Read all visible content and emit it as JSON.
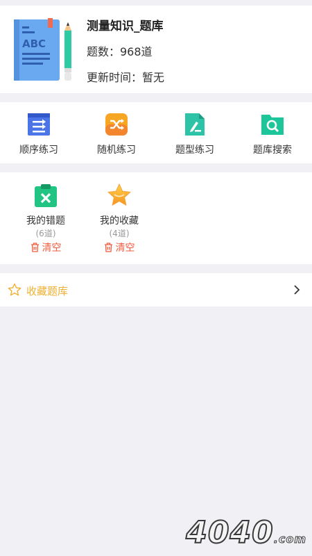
{
  "header": {
    "title": "测量知识_题库",
    "question_count": "题数：968道",
    "update_time": "更新时间：暂无",
    "book_text": "ABC"
  },
  "practice": [
    {
      "label": "顺序练习",
      "icon": "sequence-list-icon",
      "color": "#4a74e8"
    },
    {
      "label": "随机练习",
      "icon": "shuffle-icon",
      "color": "#f6a623"
    },
    {
      "label": "题型练习",
      "icon": "edit-document-icon",
      "color": "#2cc3a6"
    },
    {
      "label": "题库搜索",
      "icon": "folder-search-icon",
      "color": "#1cc59a"
    }
  ],
  "mine": [
    {
      "label": "我的错题",
      "count": "(6道)",
      "clear": "清空",
      "icon": "wrong-clipboard-icon"
    },
    {
      "label": "我的收藏",
      "count": "(4道)",
      "clear": "清空",
      "icon": "star-favorite-icon"
    }
  ],
  "favorites": {
    "label": "收藏题库"
  },
  "watermark": {
    "text": "4040",
    "suffix": ".com"
  },
  "colors": {
    "background": "#f0f0f5",
    "clear_red": "#f05a3c",
    "fav_gold": "#f0b030"
  }
}
